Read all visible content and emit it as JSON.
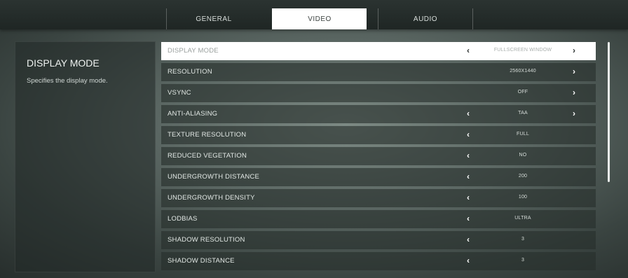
{
  "tabs": [
    {
      "label": "GENERAL",
      "active": false
    },
    {
      "label": "VIDEO",
      "active": true
    },
    {
      "label": "AUDIO",
      "active": false
    }
  ],
  "info": {
    "title": "DISPLAY MODE",
    "description": "Specifies the display mode."
  },
  "settings": [
    {
      "label": "DISPLAY MODE",
      "value": "FULLSCREEN WINDOW",
      "left_arrow": true,
      "right_arrow": true,
      "selected": true
    },
    {
      "label": "RESOLUTION",
      "value": "2560X1440",
      "left_arrow": false,
      "right_arrow": true
    },
    {
      "label": "VSYNC",
      "value": "OFF",
      "left_arrow": false,
      "right_arrow": true
    },
    {
      "label": "ANTI-ALIASING",
      "value": "TAA",
      "left_arrow": true,
      "right_arrow": true
    },
    {
      "label": "TEXTURE RESOLUTION",
      "value": "FULL",
      "left_arrow": true,
      "right_arrow": false
    },
    {
      "label": "REDUCED VEGETATION",
      "value": "NO",
      "left_arrow": true,
      "right_arrow": false
    },
    {
      "label": "UNDERGROWTH DISTANCE",
      "value": "200",
      "left_arrow": true,
      "right_arrow": false
    },
    {
      "label": "UNDERGROWTH DENSITY",
      "value": "100",
      "left_arrow": true,
      "right_arrow": false
    },
    {
      "label": "LODBIAS",
      "value": "ULTRA",
      "left_arrow": true,
      "right_arrow": false
    },
    {
      "label": "SHADOW RESOLUTION",
      "value": "3",
      "left_arrow": true,
      "right_arrow": false
    },
    {
      "label": "SHADOW DISTANCE",
      "value": "3",
      "left_arrow": true,
      "right_arrow": false
    }
  ],
  "glyphs": {
    "left": "‹",
    "right": "›"
  },
  "colors": {
    "accent": "#f2b705",
    "selected_row": "#ffffff"
  }
}
